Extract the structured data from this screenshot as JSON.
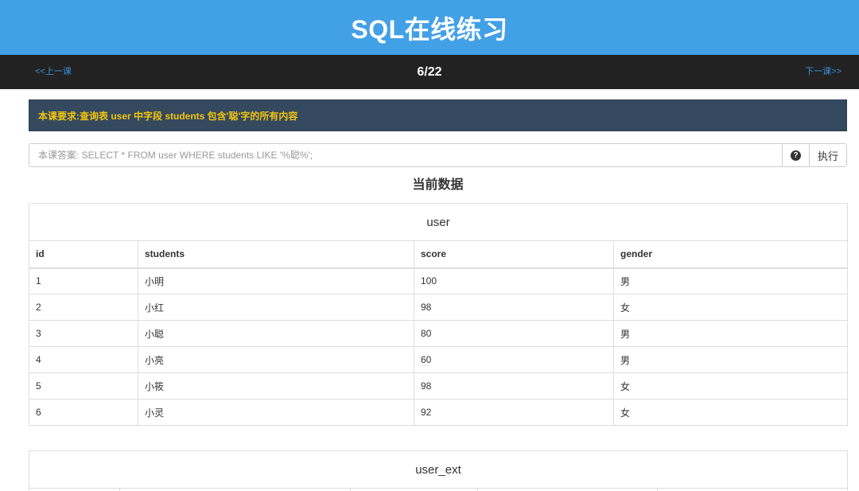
{
  "header": {
    "title": "SQL在线练习"
  },
  "nav": {
    "prev_label": "<<上一课",
    "progress": "6/22",
    "next_label": "下一课>>"
  },
  "lesson": {
    "requirement": "本课要求:查询表 user 中字段 students 包含'聪'字的所有内容"
  },
  "query": {
    "placeholder": "本课答案: SELECT * FROM user WHERE students LIKE '%聪%';",
    "help_icon": "question-circle-icon",
    "help_glyph": "?",
    "execute_label": "执行"
  },
  "data_section": {
    "title": "当前数据"
  },
  "tables": {
    "user": {
      "name": "user",
      "columns": [
        "id",
        "students",
        "score",
        "gender"
      ],
      "rows": [
        [
          "1",
          "小明",
          "100",
          "男"
        ],
        [
          "2",
          "小红",
          "98",
          "女"
        ],
        [
          "3",
          "小聪",
          "80",
          "男"
        ],
        [
          "4",
          "小亮",
          "60",
          "男"
        ],
        [
          "5",
          "小筱",
          "98",
          "女"
        ],
        [
          "6",
          "小灵",
          "92",
          "女"
        ]
      ]
    },
    "user_ext": {
      "name": "user_ext"
    }
  },
  "colors": {
    "header_bg": "#42a0e6",
    "nav_bg": "#222222",
    "link": "#3a8fd6",
    "requirement_bg": "#34495e",
    "requirement_text": "#f1c40f"
  }
}
